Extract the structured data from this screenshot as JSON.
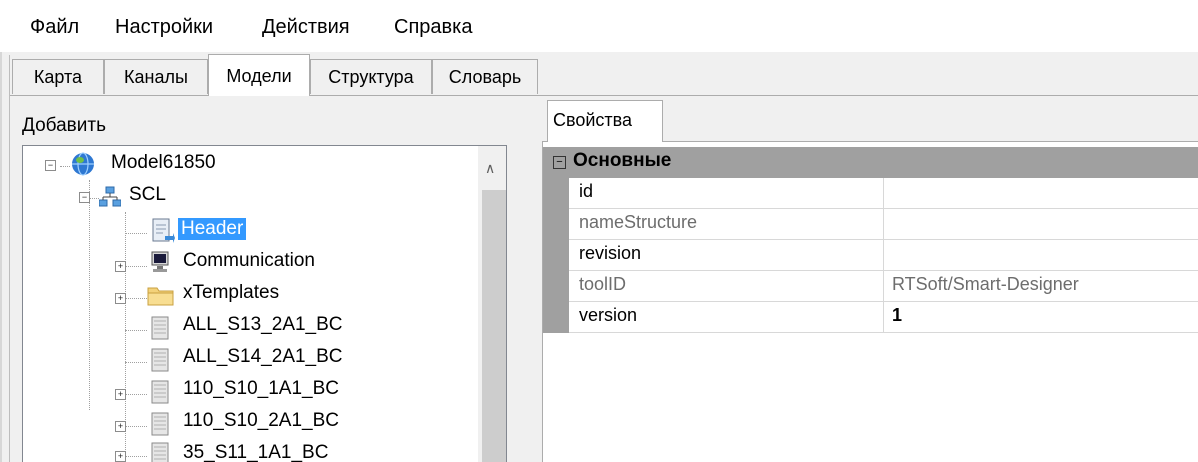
{
  "menu": {
    "items": [
      "Файл",
      "Настройки",
      "Действия",
      "Справка"
    ]
  },
  "tabs": [
    "Карта",
    "Каналы",
    "Модели",
    "Структура",
    "Словарь"
  ],
  "active_tab": "Модели",
  "left_panel": {
    "add_label": "Добавить",
    "tree": [
      {
        "label": "Model61850",
        "icon": "globe-icon",
        "expander": "minus"
      },
      {
        "label": "SCL",
        "icon": "network-icon",
        "expander": "minus"
      },
      {
        "label": "Header",
        "icon": "document-icon",
        "expander": "",
        "selected": true
      },
      {
        "label": "Communication",
        "icon": "computer-icon",
        "expander": "plus"
      },
      {
        "label": "xTemplates",
        "icon": "folder-icon",
        "expander": "plus"
      },
      {
        "label": "ALL_S13_2A1_BC",
        "icon": "server-icon",
        "expander": ""
      },
      {
        "label": "ALL_S14_2A1_BC",
        "icon": "server-icon",
        "expander": ""
      },
      {
        "label": "110_S10_1A1_BC",
        "icon": "server-icon",
        "expander": "plus"
      },
      {
        "label": "110_S10_2A1_BC",
        "icon": "server-icon",
        "expander": "plus"
      },
      {
        "label": "35_S11_1A1_BC",
        "icon": "server-icon",
        "expander": "plus"
      }
    ]
  },
  "right_panel": {
    "tab_label": "Свойства",
    "group_label": "Основные",
    "group_toggle": "⊟",
    "properties": [
      {
        "name": "id",
        "value": "",
        "readonly": false,
        "bold": false
      },
      {
        "name": "nameStructure",
        "value": "",
        "readonly": true,
        "bold": false
      },
      {
        "name": "revision",
        "value": "",
        "readonly": false,
        "bold": false
      },
      {
        "name": "toolID",
        "value": "RTSoft/Smart-Designer",
        "readonly": true,
        "bold": false
      },
      {
        "name": "version",
        "value": "1",
        "readonly": false,
        "bold": true
      }
    ]
  },
  "colors": {
    "selection": "#3399ff",
    "group_header": "#a0a0a0",
    "readonly_text": "#6d6d6d"
  }
}
